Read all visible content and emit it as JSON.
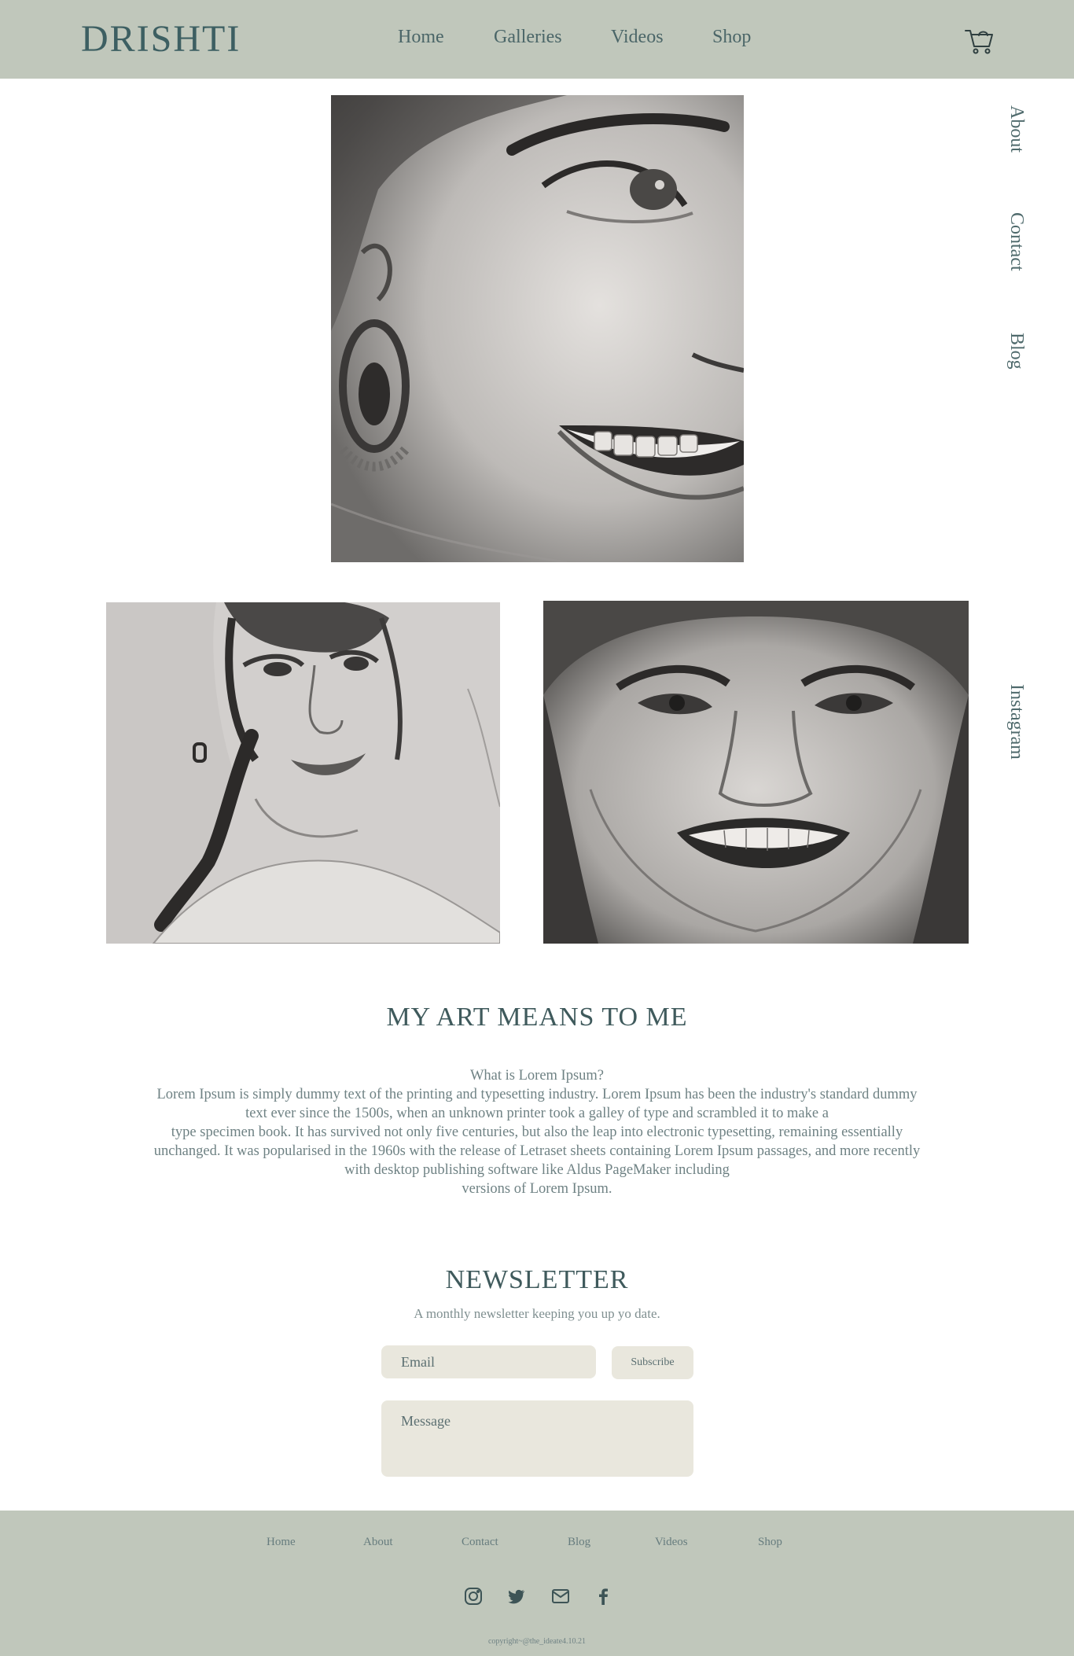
{
  "header": {
    "logo": "DRISHTI",
    "nav": [
      {
        "label": "Home"
      },
      {
        "label": "Galleries"
      },
      {
        "label": "Videos"
      },
      {
        "label": "Shop"
      }
    ],
    "cart_icon": "shopping-cart-icon"
  },
  "side_nav": {
    "items": [
      {
        "label": "About"
      },
      {
        "label": "Contact"
      },
      {
        "label": "Blog"
      },
      {
        "label": "Instagram"
      }
    ]
  },
  "gallery": {
    "images": [
      {
        "subject": "pencil sketch portrait - close-up smiling face with earring"
      },
      {
        "subject": "pencil sketch portrait - woman with ponytail"
      },
      {
        "subject": "pencil sketch portrait - smiling woman face"
      }
    ]
  },
  "about": {
    "title": "MY ART MEANS TO ME",
    "lines": [
      "What is Lorem Ipsum?",
      "Lorem Ipsum is simply dummy text of the printing and typesetting industry. Lorem Ipsum has been the industry's standard dummy",
      "text ever since the 1500s, when an unknown printer took a galley of type and scrambled it to make a",
      "type specimen book. It has survived not only five centuries, but also the leap into electronic typesetting, remaining essentially",
      "unchanged. It was popularised in the 1960s with the release of Letraset sheets containing Lorem Ipsum passages, and more recently",
      "with desktop publishing software like Aldus PageMaker including",
      "versions of Lorem Ipsum."
    ]
  },
  "newsletter": {
    "title": "NEWSLETTER",
    "subtitle": "A monthly newsletter keeping you up yo date.",
    "email_placeholder": "Email",
    "subscribe_label": "Subscribe",
    "message_placeholder": "Message"
  },
  "footer": {
    "links": [
      {
        "label": "Home"
      },
      {
        "label": "About"
      },
      {
        "label": "Contact"
      },
      {
        "label": "Blog"
      },
      {
        "label": "Videos"
      },
      {
        "label": "Shop"
      }
    ],
    "social_icons": [
      "instagram-icon",
      "twitter-icon",
      "mail-icon",
      "facebook-icon"
    ],
    "copyright": "copyright~@the_ideate4.10.21"
  },
  "colors": {
    "header_bg": "#c0c7bb",
    "accent_text": "#3d5f62",
    "input_bg": "#e9e7dd"
  }
}
